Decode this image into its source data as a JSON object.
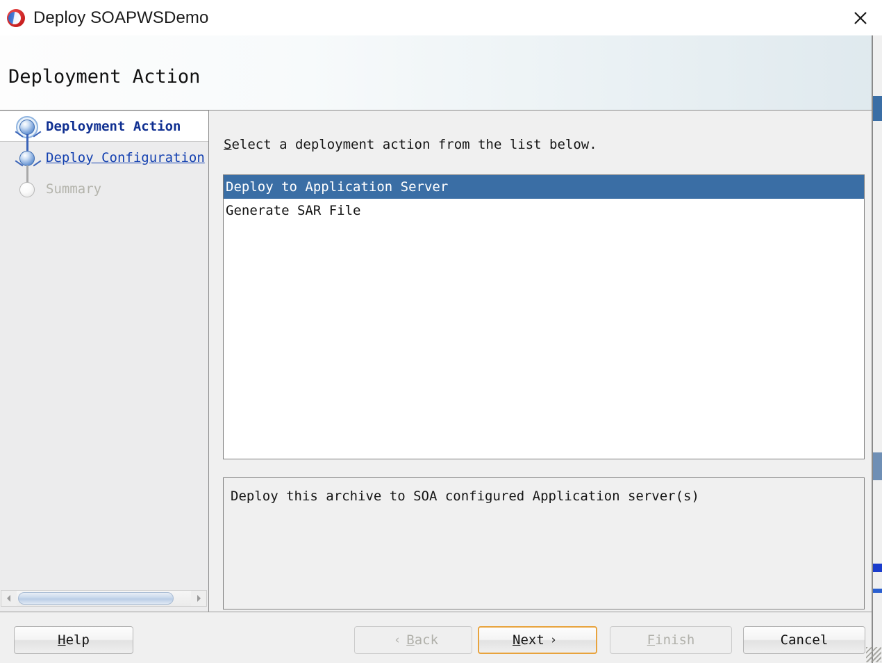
{
  "window": {
    "title": "Deploy SOAPWSDemo",
    "app_icon": "jdeveloper-logo-icon",
    "close_icon": "close-icon"
  },
  "header": {
    "title": "Deployment Action"
  },
  "sidebar": {
    "items": [
      {
        "label": "Deployment Action",
        "state": "current",
        "icon": "active-node-icon"
      },
      {
        "label": "Deploy Configuration",
        "state": "link",
        "icon": "node-icon"
      },
      {
        "label": "Summary",
        "state": "disabled",
        "icon": "inactive-node-icon"
      }
    ],
    "scrollbar": {
      "left_arrow_icon": "scroll-left-arrow-icon",
      "right_arrow_icon": "scroll-right-arrow-icon"
    }
  },
  "main": {
    "instruction_mnemonic": "S",
    "instruction_rest": "elect a deployment action from the list below.",
    "list": {
      "options": [
        {
          "label": "Deploy to Application Server",
          "selected": true
        },
        {
          "label": "Generate SAR File",
          "selected": false
        }
      ]
    },
    "description": "Deploy this archive to SOA configured Application server(s)"
  },
  "buttons": {
    "help": {
      "mnemonic": "H",
      "rest": "elp",
      "enabled": true,
      "focused": false
    },
    "back": {
      "mnemonic": "B",
      "rest": "ack",
      "enabled": false,
      "focused": false,
      "chevron": "‹"
    },
    "next": {
      "mnemonic": "N",
      "rest": "ext",
      "enabled": true,
      "focused": true,
      "chevron": "›"
    },
    "finish": {
      "mnemonic": "F",
      "rest": "inish",
      "enabled": false,
      "focused": false
    },
    "cancel": {
      "mnemonic": "",
      "rest": "Cancel",
      "enabled": true,
      "focused": false
    }
  },
  "colors": {
    "selection_blue": "#3a6ea5",
    "link_blue": "#1340b0",
    "current_step_blue": "#0f2f91",
    "focus_orange": "#e8a33d",
    "disabled_gray": "#b0b0aa"
  }
}
